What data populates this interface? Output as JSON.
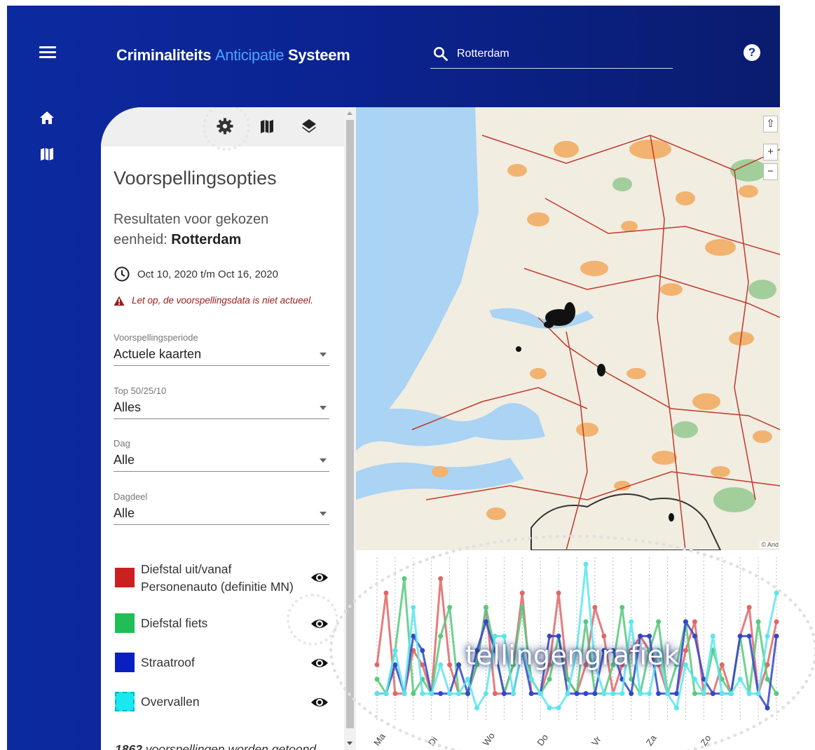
{
  "app": {
    "title_part1": "Criminaliteits",
    "title_part2": "Anticipatie",
    "title_part3": "Systeem",
    "accent_color": "#4aa3ff",
    "background_color": "#0b2390"
  },
  "header": {
    "menu_icon": "hamburger-menu-icon",
    "search_icon": "search-icon",
    "search_value": "Rotterdam",
    "help_icon": "help-icon",
    "help_label": "?"
  },
  "left_rail": {
    "items": [
      {
        "icon": "home-icon"
      },
      {
        "icon": "map-icon"
      }
    ]
  },
  "panel": {
    "tabs": [
      {
        "icon": "settings-gear-icon",
        "active": true
      },
      {
        "icon": "map-icon"
      },
      {
        "icon": "layers-icon"
      }
    ],
    "heading": "Voorspellingsopties",
    "result_prefix": "Resultaten voor gekozen eenheid: ",
    "result_unit": "Rotterdam",
    "date_range": "Oct 10, 2020 t/m Oct 16, 2020",
    "warning": "Let op, de voorspellingsdata is niet actueel.",
    "selects": [
      {
        "label": "Voorspellingsperiode",
        "value": "Actuele kaarten"
      },
      {
        "label": "Top 50/25/10",
        "value": "Alles"
      },
      {
        "label": "Dag",
        "value": "Alle"
      },
      {
        "label": "Dagdeel",
        "value": "Alle"
      }
    ],
    "legend": [
      {
        "label": "Diefstal uit/vanaf Personenauto (definitie MN)",
        "color": "#cc1f1f",
        "visible": true
      },
      {
        "label": "Diefstal fiets",
        "color": "#1fbf55",
        "visible": true
      },
      {
        "label": "Straatroof",
        "color": "#0a1fc2",
        "visible": true
      },
      {
        "label": "Overvallen",
        "color": "#19e8f0",
        "visible": true
      }
    ],
    "count_value": "1862",
    "count_suffix": " voorspellingen worden getoond"
  },
  "map": {
    "controls": [
      "⇧",
      "+",
      "−"
    ],
    "attribution": "© And"
  },
  "overlay_label": "tellingengrafiek",
  "chart_data": {
    "type": "line",
    "x_tick_labels": [
      "Ma",
      "Di",
      "Wo",
      "Do",
      "Vr",
      "Za",
      "Zo"
    ],
    "points_per_day": 6,
    "grid": "vertical dotted",
    "series": [
      {
        "color": "#e06666",
        "values": [
          3,
          8,
          1,
          1,
          4,
          3,
          1,
          9,
          3,
          1,
          1,
          3,
          7,
          1,
          1,
          3,
          8,
          1,
          1,
          3,
          8,
          2,
          1,
          3,
          7,
          5,
          1,
          3,
          4,
          5,
          4,
          3,
          1,
          1,
          4,
          6,
          1,
          1,
          3,
          1,
          5,
          7,
          1,
          3,
          6
        ]
      },
      {
        "color": "#57c97d",
        "values": [
          2,
          1,
          4,
          9,
          1,
          2,
          1,
          5,
          7,
          1,
          1,
          3,
          7,
          4,
          1,
          3,
          7,
          2,
          1,
          2,
          5,
          2,
          1,
          6,
          1,
          1,
          3,
          7,
          2,
          1,
          4,
          6,
          1,
          3,
          6,
          1,
          1,
          4,
          2,
          1,
          5,
          1,
          6,
          2,
          1
        ]
      },
      {
        "color": "#3347c9",
        "values": [
          1,
          1,
          3,
          1,
          5,
          4,
          1,
          1,
          1,
          3,
          1,
          4,
          6,
          4,
          1,
          1,
          4,
          1,
          1,
          5,
          5,
          1,
          1,
          1,
          1,
          4,
          4,
          2,
          1,
          5,
          5,
          1,
          1,
          1,
          6,
          5,
          2,
          1,
          1,
          1,
          5,
          5,
          1,
          0,
          5
        ]
      },
      {
        "color": "#5be6ee",
        "values": [
          1,
          1,
          4,
          1,
          7,
          1,
          1,
          3,
          1,
          1,
          2,
          0,
          1,
          5,
          5,
          1,
          4,
          2,
          1,
          0,
          0,
          1,
          4,
          10,
          3,
          1,
          1,
          1,
          6,
          1,
          1,
          4,
          1,
          0,
          3,
          2,
          1,
          5,
          1,
          1,
          2,
          1,
          1,
          5,
          8
        ]
      }
    ],
    "ylim": [
      0,
      10
    ]
  }
}
